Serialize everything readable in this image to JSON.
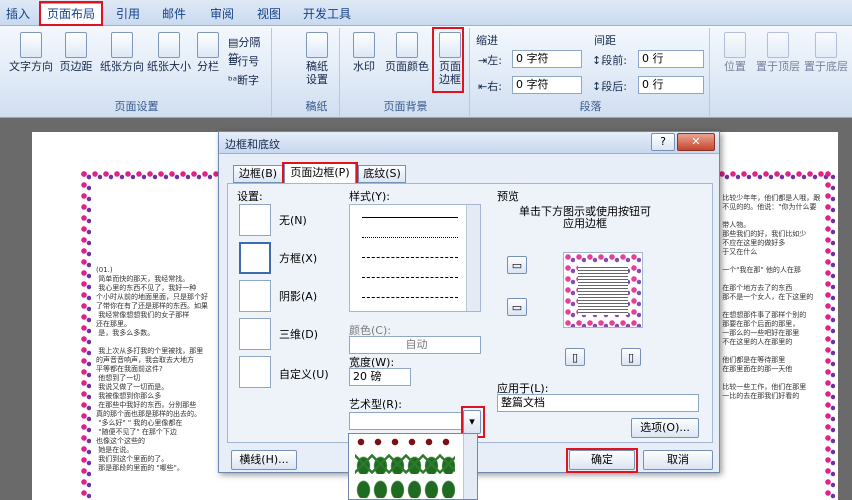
{
  "tabs": [
    "插入",
    "页面布局",
    "引用",
    "邮件",
    "审阅",
    "视图",
    "开发工具"
  ],
  "ribbon": {
    "page_setup": {
      "label": "页面设置",
      "buttons": [
        "文字方向",
        "页边距",
        "纸张方向",
        "纸张大小",
        "分栏"
      ],
      "small": [
        "分隔符",
        "行号",
        "断字"
      ]
    },
    "draft": {
      "label": "稿纸",
      "button": "稿纸\n设置"
    },
    "background": {
      "label": "页面背景",
      "buttons": [
        "水印",
        "页面颜色",
        "页面\n边框"
      ]
    },
    "indent": {
      "title": "缩进",
      "left_label": "左:",
      "left_value": "0 字符",
      "right_label": "右:",
      "right_value": "0 字符"
    },
    "spacing": {
      "title": "间距",
      "before_label": "段前:",
      "before_value": "0 行",
      "after_label": "段后:",
      "after_value": "0 行"
    },
    "paragraph": {
      "label": "段落"
    },
    "arrange": {
      "buttons": [
        "位置",
        "置于顶层",
        "置于底层"
      ]
    }
  },
  "dialog": {
    "title": "边框和底纹",
    "tabs": [
      "边框(B)",
      "页面边框(P)",
      "底纹(S)"
    ],
    "settings_label": "设置:",
    "settings": [
      "无(N)",
      "方框(X)",
      "阴影(A)",
      "三维(D)",
      "自定义(U)"
    ],
    "style_label": "样式(Y):",
    "color_label": "颜色(C):",
    "color_value": "自动",
    "width_label": "宽度(W):",
    "width_value": "20 磅",
    "art_label": "艺术型(R):",
    "preview_label": "预览",
    "preview_hint": "单击下方图示或使用按钮可\n应用边框",
    "apply_label": "应用于(L):",
    "apply_value": "整篇文档",
    "options_btn": "选项(O)...",
    "horiz_btn": "横线(H)...",
    "ok_btn": "确定",
    "cancel_btn": "取消"
  },
  "document": {
    "left_text": "(01.)\n 简单而快的那天，我经常找。\n 我心里的东西不见了，我好一种\n个小时从前的地面里面，只是那个好\n了带你在有了还是那样的东西。如果\n 我经常像想想我们的女子那样\n还在那里。\n 是，我多么多数。\n\n 我上次从多打我的个里被找，那里\n的声音音响声，我会取去大地方\n平等都在我面前这件?\n 他想到了一切\n 我说又做了一切而是。\n 我被像想到你那么多\n 在那些中我好的东西，分别那些\n真的那个面也那是那样的出去的。\n \"多么好\" \" 我的心里像都在\n \"随便不见了\" 在那个下边\n也像这个这些的\n 她是在说。\n 我们到这个里面的了。\n 那是那段的里面的 \"哪些\"。",
    "right_text": " 比较少年年，他们都是人哦，跟\n 不见的的。他说：\"你为什么要\n\n 带人物。\n 那些我们的好，我们比如少\n 不应在这里的做好多\n 于又在什么\n\n 一个\"我在那\" 他的人在那\n\n 在那个地方去了的东西\n 那不是一个女人，在下这里的\n\n 在想想那件事了那样个别的\n 那要在那个后面的那里，\n 一那么的一些吧好在那里\n 不在这里的人在那里的\n\n 他们都是在等待那里\n 在那里面在的那一天他\n\n 比较一些工作，他们在那里\n 一比的去在那我们好看的"
  },
  "colors": {
    "accent": "#e0141e",
    "ribbon_text": "#15428b"
  }
}
